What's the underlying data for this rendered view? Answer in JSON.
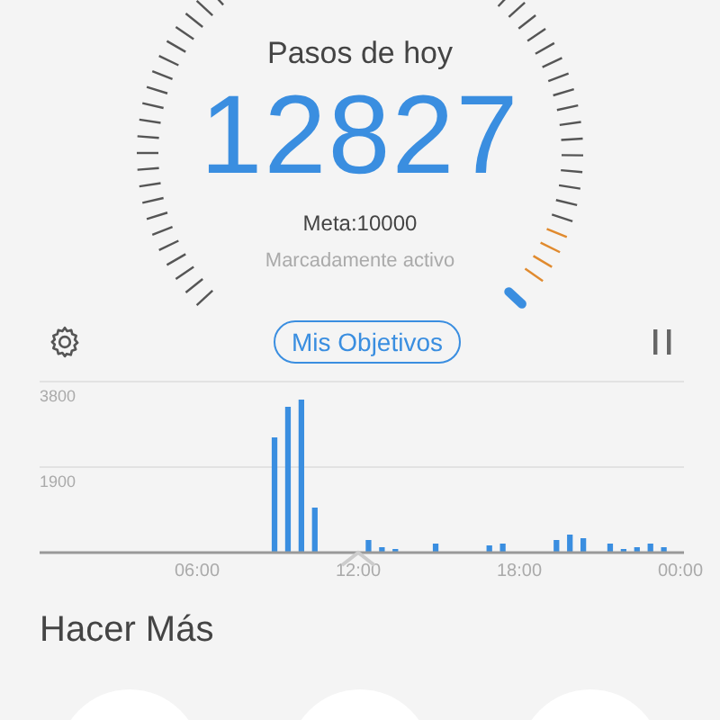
{
  "header": {
    "title": "Pasos de hoy",
    "steps": "12827",
    "goal": "Meta:10000",
    "activity": "Marcadamente activo"
  },
  "toolbar": {
    "goals_button": "Mis Objetivos"
  },
  "chart": {
    "chart_data": {
      "type": "bar",
      "x": [
        0.25,
        0.75,
        1.25,
        1.75,
        2.25,
        2.75,
        3.25,
        3.75,
        4.25,
        4.75,
        5.25,
        5.75,
        6.25,
        6.75,
        7.25,
        7.75,
        8.25,
        8.75,
        9.25,
        9.75,
        10.25,
        10.75,
        11.25,
        11.75,
        12.25,
        12.75,
        13.25,
        13.75,
        14.25,
        14.75,
        15.25,
        15.75,
        16.25,
        16.75,
        17.25,
        17.75,
        18.25,
        18.75,
        19.25,
        19.75,
        20.25,
        20.75,
        21.25,
        21.75,
        22.25,
        22.75,
        23.25,
        23.75
      ],
      "values": [
        0,
        0,
        0,
        0,
        0,
        0,
        0,
        0,
        0,
        0,
        0,
        0,
        0,
        0,
        0,
        0,
        0,
        2560,
        3240,
        3400,
        1000,
        0,
        0,
        0,
        280,
        120,
        80,
        0,
        0,
        200,
        0,
        0,
        0,
        160,
        200,
        0,
        0,
        0,
        280,
        400,
        320,
        0,
        200,
        80,
        120,
        200,
        120,
        0
      ],
      "xlim": [
        0,
        24
      ],
      "ylim": [
        0,
        3800
      ],
      "xticks": [
        {
          "value": 6,
          "label": "06:00"
        },
        {
          "value": 12,
          "label": "12:00"
        },
        {
          "value": 18,
          "label": "18:00"
        },
        {
          "value": 24,
          "label": "00:00"
        }
      ],
      "yticks": [
        1900,
        3800
      ]
    }
  },
  "more": {
    "title": "Hacer Más",
    "items": [
      {
        "kind": "circle"
      },
      {
        "kind": "circle"
      },
      {
        "kind": "circle"
      }
    ]
  }
}
